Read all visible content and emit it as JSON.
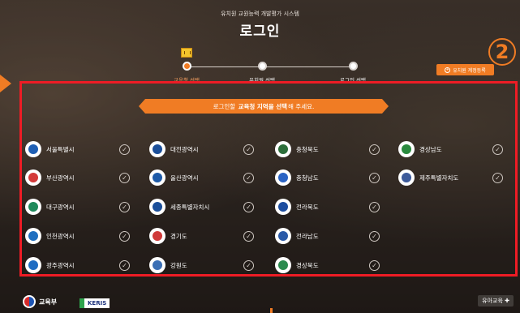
{
  "header": {
    "system_title": "유치원 교원능력 개발평가 시스템",
    "page_title": "로그인"
  },
  "steps": [
    {
      "label": "교육청 선택",
      "active": true
    },
    {
      "label": "유치원 선택",
      "active": false
    },
    {
      "label": "로그인 선택",
      "active": false
    }
  ],
  "register_button": {
    "label": "유치원 계정등록"
  },
  "annotation_number": "2",
  "banner": {
    "prefix": "로그인할",
    "emphasis": "교육청 지역을 선택",
    "suffix": "해 주세요."
  },
  "regions": [
    {
      "name": "서울특별시",
      "color": "#1f5fb4"
    },
    {
      "name": "대전광역시",
      "color": "#1b4f9a"
    },
    {
      "name": "충청북도",
      "color": "#2c6e3a"
    },
    {
      "name": "경상남도",
      "color": "#2a8a3e"
    },
    {
      "name": "부산광역시",
      "color": "#d43a3a"
    },
    {
      "name": "울산광역시",
      "color": "#1d5aa8"
    },
    {
      "name": "충청남도",
      "color": "#2a63c4"
    },
    {
      "name": "제주특별자치도",
      "color": "#3c5a9a"
    },
    {
      "name": "대구광역시",
      "color": "#1f8a5b"
    },
    {
      "name": "세종특별자치시",
      "color": "#1b4f9a"
    },
    {
      "name": "전라북도",
      "color": "#1d4ea0"
    },
    {
      "name": "인천광역시",
      "color": "#1f6fc0"
    },
    {
      "name": "경기도",
      "color": "#d03a3a"
    },
    {
      "name": "전라남도",
      "color": "#2a5aa8"
    },
    {
      "name": "광주광역시",
      "color": "#1e6cc2"
    },
    {
      "name": "강원도",
      "color": "#3b6fb5"
    },
    {
      "name": "경상북도",
      "color": "#2a8a4e"
    }
  ],
  "check_glyph": "✓",
  "footer": {
    "moe": "교육부",
    "keris": "KERIS",
    "right_logo": "유아교육 ✚"
  },
  "colors": {
    "accent": "#f07c24",
    "highlight_border": "#ee1c25"
  }
}
